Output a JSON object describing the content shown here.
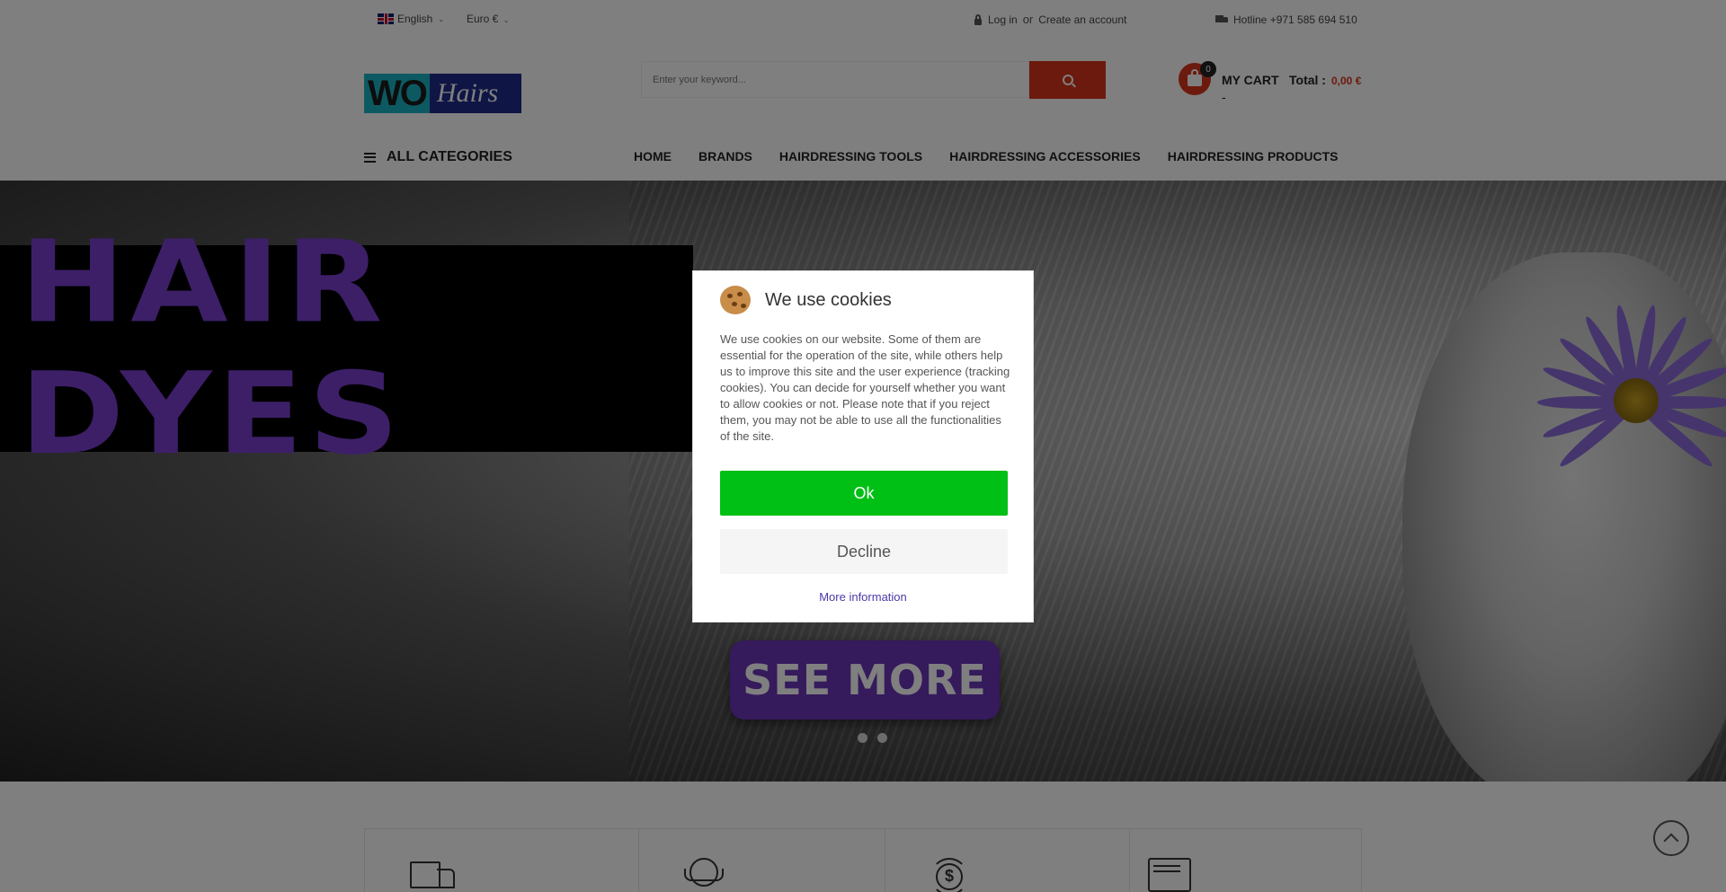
{
  "header": {
    "language": "English",
    "currency": "Euro €",
    "login": "Log in",
    "or": "or",
    "create_account": "Create an account",
    "hotline": "Hotline +971 585 694 510",
    "logo_wo": "WO",
    "logo_hairs": "Hairs",
    "search_placeholder": "Enter your keyword...",
    "cart": {
      "count": "0",
      "label": "MY CART",
      "total_label": "Total :",
      "total_value": "0,00 €",
      "dash": "-"
    },
    "all_categories": "ALL CATEGORIES",
    "nav": [
      "HOME",
      "BRANDS",
      "HAIRDRESSING TOOLS",
      "HAIRDRESSING ACCESSORIES",
      "HAIRDRESSING PRODUCTS"
    ]
  },
  "hero": {
    "title": "HAIR DYES",
    "cta": "SEE MORE",
    "slides": 2
  },
  "cookie_modal": {
    "title": "We use cookies",
    "body": "We use cookies on our website. Some of them are essential for the operation of the site, while others help us to improve this site and the user experience (tracking cookies). You can decide for yourself whether you want to allow cookies or not. Please note that if you reject them, you may not be able to use all the functionalities of the site.",
    "ok_label": "Ok",
    "decline_label": "Decline",
    "more_info_label": "More information"
  },
  "colors": {
    "accent": "#d9341b",
    "ok_green": "#00bf15",
    "hero_purple": "#7b3fd0",
    "link_purple": "#4a3aa8"
  },
  "icons": [
    "flag-uk-icon",
    "lock-icon",
    "truck-icon",
    "search-icon",
    "cart-bag-icon",
    "list-icon",
    "cookie-icon",
    "chevron-up-icon"
  ]
}
